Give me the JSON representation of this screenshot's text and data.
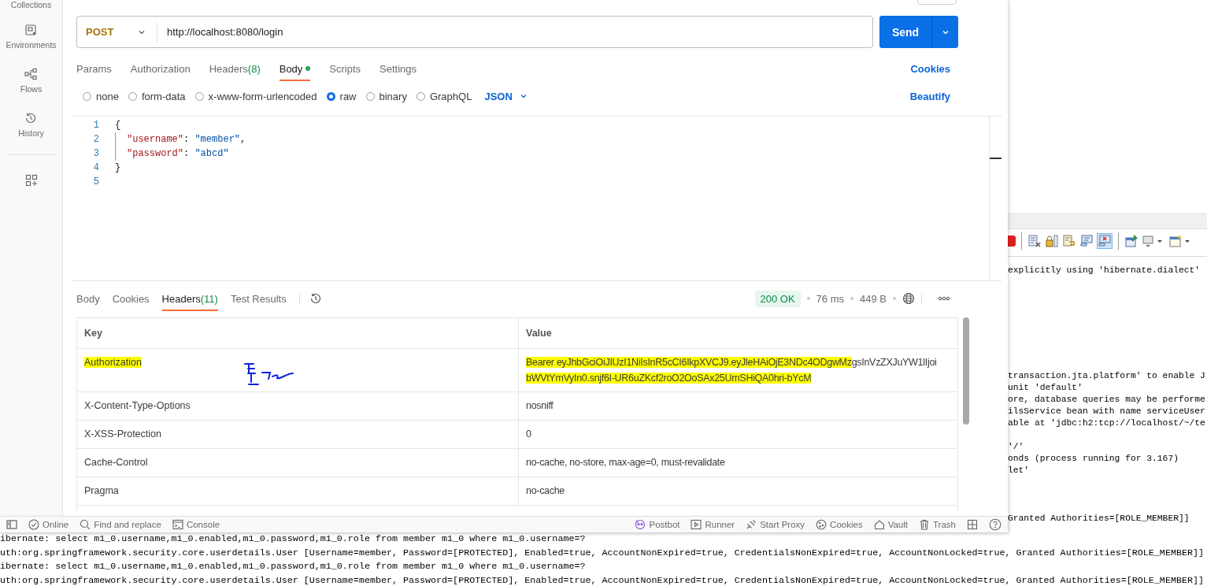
{
  "sidebar": {
    "items": [
      {
        "kind": "collections",
        "label": "Collections"
      },
      {
        "kind": "environments",
        "label": "Environments"
      },
      {
        "kind": "flows",
        "label": "Flows"
      },
      {
        "kind": "history",
        "label": "History"
      }
    ]
  },
  "request": {
    "method": "POST",
    "url": "http://localhost:8080/login",
    "send_label": "Send"
  },
  "request_tabs": [
    {
      "label": "Params",
      "selected": false,
      "dot": false
    },
    {
      "label": "Authorization",
      "selected": false,
      "dot": false
    },
    {
      "label": "Headers",
      "count": "(8)",
      "selected": false,
      "dot": false
    },
    {
      "label": "Body",
      "selected": true,
      "dot": true
    },
    {
      "label": "Scripts",
      "selected": false,
      "dot": false
    },
    {
      "label": "Settings",
      "selected": false,
      "dot": false
    }
  ],
  "cookies_link": "Cookies",
  "body_types": [
    {
      "label": "none",
      "selected": false
    },
    {
      "label": "form-data",
      "selected": false
    },
    {
      "label": "x-www-form-urlencoded",
      "selected": false
    },
    {
      "label": "raw",
      "selected": true
    },
    {
      "label": "binary",
      "selected": false
    },
    {
      "label": "GraphQL",
      "selected": false
    }
  ],
  "format": "JSON",
  "beautify": "Beautify",
  "editor": {
    "lines": [
      {
        "number": "1",
        "indented": false,
        "tokens": [
          {
            "kind": "punct",
            "text": "{"
          }
        ]
      },
      {
        "number": "2",
        "indented": true,
        "tokens": [
          {
            "kind": "key",
            "text": "\"username\""
          },
          {
            "kind": "punct",
            "text": ": "
          },
          {
            "kind": "string",
            "text": "\"member\""
          },
          {
            "kind": "punct",
            "text": ","
          }
        ]
      },
      {
        "number": "3",
        "indented": true,
        "tokens": [
          {
            "kind": "key",
            "text": "\"password\""
          },
          {
            "kind": "punct",
            "text": ": "
          },
          {
            "kind": "string",
            "text": "\"abcd\""
          }
        ]
      },
      {
        "number": "4",
        "indented": false,
        "tokens": [
          {
            "kind": "punct",
            "text": "}"
          }
        ]
      },
      {
        "number": "5",
        "indented": false
      }
    ]
  },
  "response_tabs": [
    {
      "label": "Body",
      "selected": false
    },
    {
      "label": "Cookies",
      "selected": false
    },
    {
      "label": "Headers",
      "count": "(11)",
      "selected": true
    },
    {
      "label": "Test Results",
      "selected": false
    }
  ],
  "response_meta": {
    "status": "200 OK",
    "time": "76 ms",
    "size": "449 B"
  },
  "headers_table": {
    "columns": [
      "Key",
      "Value"
    ],
    "rows": [
      {
        "key": "Authorization",
        "key_highlighted": true,
        "scribble": true,
        "value_lines": [
          [
            {
              "text": "Bearer eyJhbGciOiJIUzI1NiIsInR5cCI6IkpXVCJ9.eyJleHAiOjE3NDc4ODgwMz",
              "highlighted": true
            },
            {
              "text": "gsInVzZXJuYW1lIjoi",
              "highlighted": false
            }
          ],
          [
            {
              "text": "bWVtYmVyIn0.snjf6I-UR6uZKcf2roO2OoSAx25UmSHiQA0hri-bYcM",
              "highlighted": true
            }
          ]
        ]
      },
      {
        "key": "X-Content-Type-Options",
        "key_highlighted": false,
        "scribble": false,
        "value_lines": [
          [
            {
              "text": "nosniff",
              "highlighted": false
            }
          ]
        ]
      },
      {
        "key": "X-XSS-Protection",
        "key_highlighted": false,
        "scribble": false,
        "value_lines": [
          [
            {
              "text": "0",
              "highlighted": false
            }
          ]
        ]
      },
      {
        "key": "Cache-Control",
        "key_highlighted": false,
        "scribble": false,
        "value_lines": [
          [
            {
              "text": "no-cache, no-store, max-age=0, must-revalidate",
              "highlighted": false
            }
          ]
        ]
      },
      {
        "key": "Pragma",
        "key_highlighted": false,
        "scribble": false,
        "value_lines": [
          [
            {
              "text": "no-cache",
              "highlighted": false
            }
          ]
        ]
      }
    ]
  },
  "footer": {
    "left": [
      {
        "kind": "online",
        "label": "Online"
      },
      {
        "kind": "search",
        "label": "Find and replace"
      },
      {
        "kind": "console",
        "label": "Console"
      }
    ],
    "right": [
      {
        "kind": "postbot",
        "label": "Postbot"
      },
      {
        "kind": "runner",
        "label": "Runner"
      },
      {
        "kind": "proxy",
        "label": "Start Proxy"
      },
      {
        "kind": "cookies",
        "label": "Cookies"
      },
      {
        "kind": "vault",
        "label": "Vault"
      },
      {
        "kind": "trash",
        "label": "Trash"
      }
    ]
  },
  "console_side": {
    "blocks": [
      [
        "explicitly using 'hibernate.dialect'"
      ],
      [
        "transaction.jta.platform' to enable J",
        "unit 'default'",
        "ore, database queries may be performe",
        "ilsService bean with name serviceUser",
        "able at 'jdbc:h2:tcp://localhost/~/te"
      ],
      [
        "'/'",
        "onds (process running for 3.167)",
        "let'"
      ],
      [
        "Granted Authorities=[ROLE_MEMBER]]"
      ]
    ]
  },
  "console_bottom": [
    "ibernate: select m1_0.username,m1_0.enabled,m1_0.password,m1_0.role from member m1_0 where m1_0.username=?",
    "uth:org.springframework.security.core.userdetails.User [Username=member, Password=[PROTECTED], Enabled=true, AccountNonExpired=true, CredentialsNonExpired=true, AccountNonLocked=true, Granted Authorities=[ROLE_MEMBER]]",
    "ibernate: select m1_0.username,m1_0.enabled,m1_0.password,m1_0.role from member m1_0 where m1_0.username=?",
    "uth:org.springframework.security.core.userdetails.User [Username=member, Password=[PROTECTED], Enabled=true, AccountNonExpired=true, CredentialsNonExpired=true, AccountNonLocked=true, Granted Authorities=[ROLE_MEMBER]]"
  ]
}
